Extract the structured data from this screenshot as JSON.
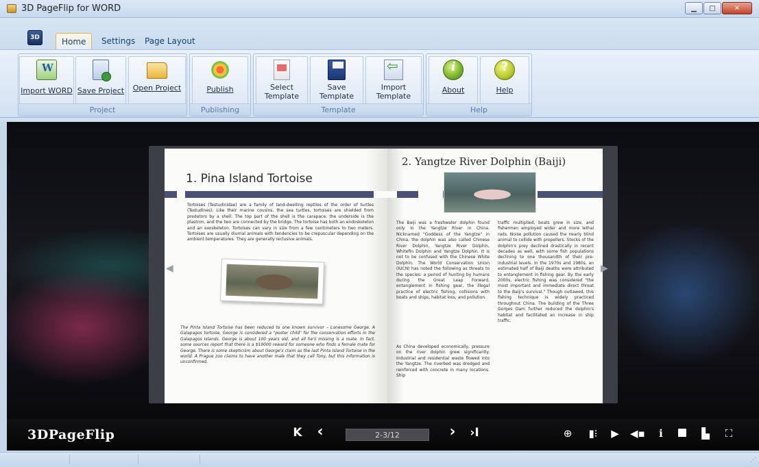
{
  "window": {
    "title": "3D PageFlip for WORD",
    "controls": [
      "minimize",
      "maximize",
      "close"
    ]
  },
  "ribbon": {
    "app_button_label": "3D",
    "tabs": [
      {
        "label": "Home",
        "active": true
      },
      {
        "label": "Settings",
        "active": false
      },
      {
        "label": "Page Layout",
        "active": false
      }
    ],
    "groups": {
      "project": {
        "label": "Project",
        "buttons": [
          {
            "label": "Import WORD",
            "icon": "word-import-icon"
          },
          {
            "label": "Save Project",
            "icon": "save-project-icon"
          },
          {
            "label": "Open Project",
            "icon": "folder-icon"
          }
        ]
      },
      "publishing": {
        "label": "Publishing",
        "buttons": [
          {
            "label": "Publish",
            "icon": "publish-icon"
          }
        ]
      },
      "template": {
        "label": "Template",
        "buttons": [
          {
            "line1": "Select",
            "line2": "Template",
            "icon": "select-template-icon"
          },
          {
            "line1": "Save",
            "line2": "Template",
            "icon": "floppy-disk-icon"
          },
          {
            "line1": "Import",
            "line2": "Template",
            "icon": "import-arrow-icon"
          }
        ]
      },
      "help": {
        "label": "Help",
        "buttons": [
          {
            "label": "About",
            "icon": "info-icon"
          },
          {
            "label": "Help",
            "icon": "help-icon"
          }
        ]
      }
    }
  },
  "book": {
    "left_page": {
      "title": "1. Pina Island Tortoise",
      "para1": "Tortoises (Testudinidae) are a family of land-dwelling reptiles of the order of turtles (Testudines). Like their marine cousins, the sea turtles, tortoises are shielded from predators by a shell. The top part of the shell is the carapace, the underside is the plastron, and the two are connected by the bridge. The tortoise has both an endoskeleton and an exoskeleton. Tortoises can vary in size from a few centimeters to two meters. Tortoises are usually diurnal animals with tendencies to be crepuscular depending on the ambient temperatures. They are generally reclusive animals.",
      "para2": "The Pinta Island Tortoise has been reduced to one known survivor – Lonesome George. A Galapagos tortoise, George is considered a \"poster child\" for the conservation efforts in the Galapagos Islands. George is about 100 years old, and all he's missing is a mate. In fact, some sources report that there is a $10000 reward for someone who finds a female mate for George. There is some skepticism about George's claim as the last Pinta Island Tortoise in the world. A Prague zoo claims to have another male that they call Tony, but this information is unconfirmed.",
      "image": "tortoise-photo"
    },
    "right_page": {
      "title": "2. Yangtze River Dolphin (Baiji)",
      "col1_para1": "The Baiji was a freshwater dolphin found only in the Yangtze River in China. Nicknamed \"Goddess of the Yangtze\" in China, the dolphin was also called Chinese River Dolphin, Yangtze River Dolphin, Whitefin Dolphin and Yangtze Dolphin. It is not to be confused with the Chinese White Dolphin. The World Conservation Union (IUCN) has noted the following as threats to the species: a period of hunting by humans during the Great Leap Forward, entanglement in fishing gear, the illegal practice of electric fishing, collisions with boats and ships, habitat loss, and pollution.",
      "col1_para2": "As China developed economically, pressure on the river dolphin grew significantly. Industrial and residential waste flowed into the Yangtze. The riverbed was dredged and reinforced with concrete in many locations. Ship",
      "col2": "traffic multiplied, boats grew in size, and fishermen employed wider and more lethal nets. Noise pollution caused the nearly blind animal to collide with propellers. Stocks of the dolphin's prey declined drastically in recent decades as well, with some fish populations declining to one thousandth of their pre-industrial levels. In the 1970s and 1980s, an estimated half of Baiji deaths were attributed to entanglement in fishing gear. By the early 2000s, electric fishing was considered \"the most important and immediate direct threat to the Baiji's survival.\" Though outlawed, this fishing technique is widely practiced throughout China. The building of the Three Gorges Dam further reduced the dolphin's habitat and facilitated an increase in ship traffic.",
      "image": "dolphin-photo"
    }
  },
  "viewer_toolbar": {
    "brand": "3DPageFlip",
    "first_page": "K",
    "prev_page": "‹",
    "page_indicator": "2-3/12",
    "next_page": "›",
    "last_page": "›I",
    "tools": [
      "zoom-icon",
      "thumbnails-icon",
      "autoplay-icon",
      "sound-icon",
      "info-icon",
      "share-icon",
      "print-icon",
      "fullscreen-icon"
    ],
    "info_glyph": "i"
  },
  "colors": {
    "ribbon_bg": "#d2e1f2",
    "book_banner": "#4b5077",
    "toolbar_bg": "#050506"
  }
}
